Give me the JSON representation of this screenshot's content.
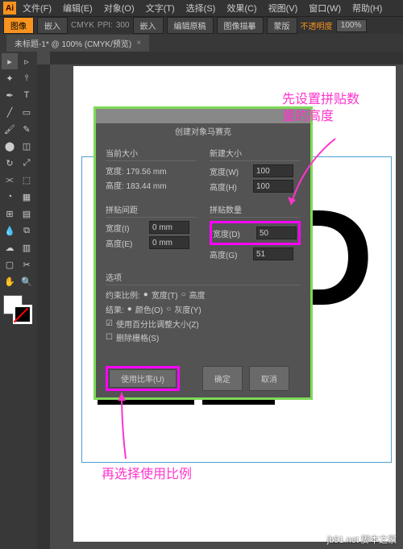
{
  "menubar": {
    "items": [
      "文件(F)",
      "编辑(E)",
      "对象(O)",
      "文字(T)",
      "选择(S)",
      "效果(C)",
      "视图(V)",
      "窗口(W)",
      "帮助(H)"
    ]
  },
  "optbar": {
    "imageBtn": "图像",
    "embedBtn": "嵌入",
    "colorMode": "CMYK",
    "ppiLabel": "PPI:",
    "ppiValue": "300",
    "embed2": "嵌入",
    "editOriginal": "编辑原稿",
    "imageTrace": "图像描摹",
    "mask": "蒙版",
    "opacityLabel": "不透明度",
    "opacityValue": "100%"
  },
  "tab": {
    "name": "未标题-1* @ 100% (CMYK/预览)",
    "close": "×"
  },
  "dialog": {
    "title": "创建对象马赛克",
    "currentSize": "当前大小",
    "newSize": "新建大小",
    "widthLabelW": "宽度(W)",
    "heightLabelH": "高度(H)",
    "curWidth": "宽度: 179.56 mm",
    "curHeight": "高度: 183.44 mm",
    "newWidthVal": "100",
    "newHeightVal": "100",
    "tileSpacing": "拼贴间距",
    "tileCount": "拼贴数量",
    "widthI": "宽度(I)",
    "heightE": "高度(E)",
    "widthD": "宽度(D)",
    "heightG": "高度(G)",
    "spacingW": "0 mm",
    "spacingH": "0 mm",
    "countW": "50",
    "countH": "51",
    "options": "选项",
    "constrainLabel": "约束比例:",
    "constrainW": "宽度(T)",
    "constrainH": "高度",
    "resultLabel": "结果:",
    "resultColor": "颜色(O)",
    "resultGray": "灰度(Y)",
    "usePercent": "使用百分比调整大小(Z)",
    "deleteRaster": "删除栅格(S)",
    "useRatioBtn": "使用比率(U)",
    "okBtn": "确定",
    "cancelBtn": "取消"
  },
  "annotations": {
    "top": "先设置拼贴数\n量的高度",
    "bottom": "再选择使用比例"
  },
  "watermark": "jb51.net  脚本之家",
  "canvas": {
    "text": "LED"
  }
}
